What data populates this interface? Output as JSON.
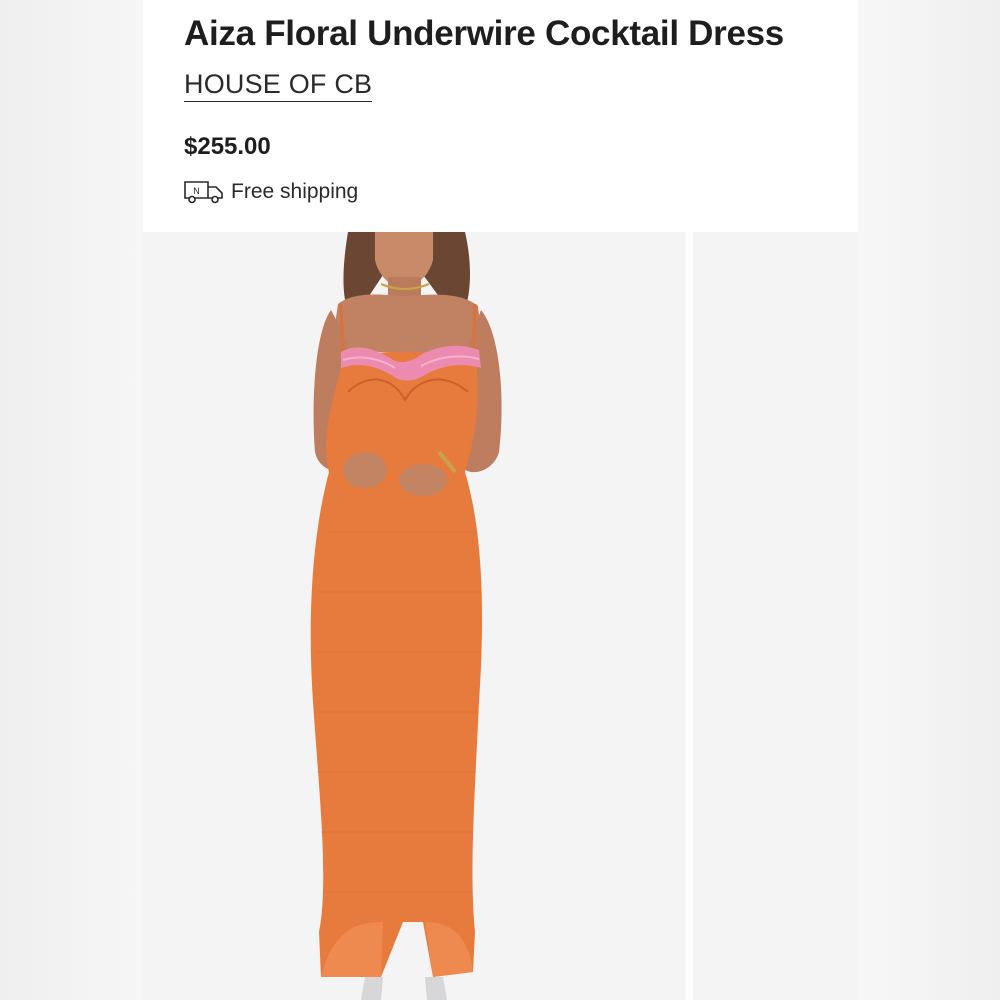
{
  "product": {
    "title": "Aiza Floral Underwire Cocktail Dress",
    "brand": "HOUSE OF CB",
    "price": "$255.00",
    "shipping_label": "Free shipping",
    "shipping_icon": "delivery-truck-icon",
    "shipping_icon_text": "N"
  },
  "gallery": {
    "main_image": "orange-mesh-maxi-dress-on-model",
    "next_image": "partial-next-photo"
  },
  "colors": {
    "dress": "#e77b3d",
    "lace": "#ec8ab0",
    "text": "#1e1e1e"
  }
}
